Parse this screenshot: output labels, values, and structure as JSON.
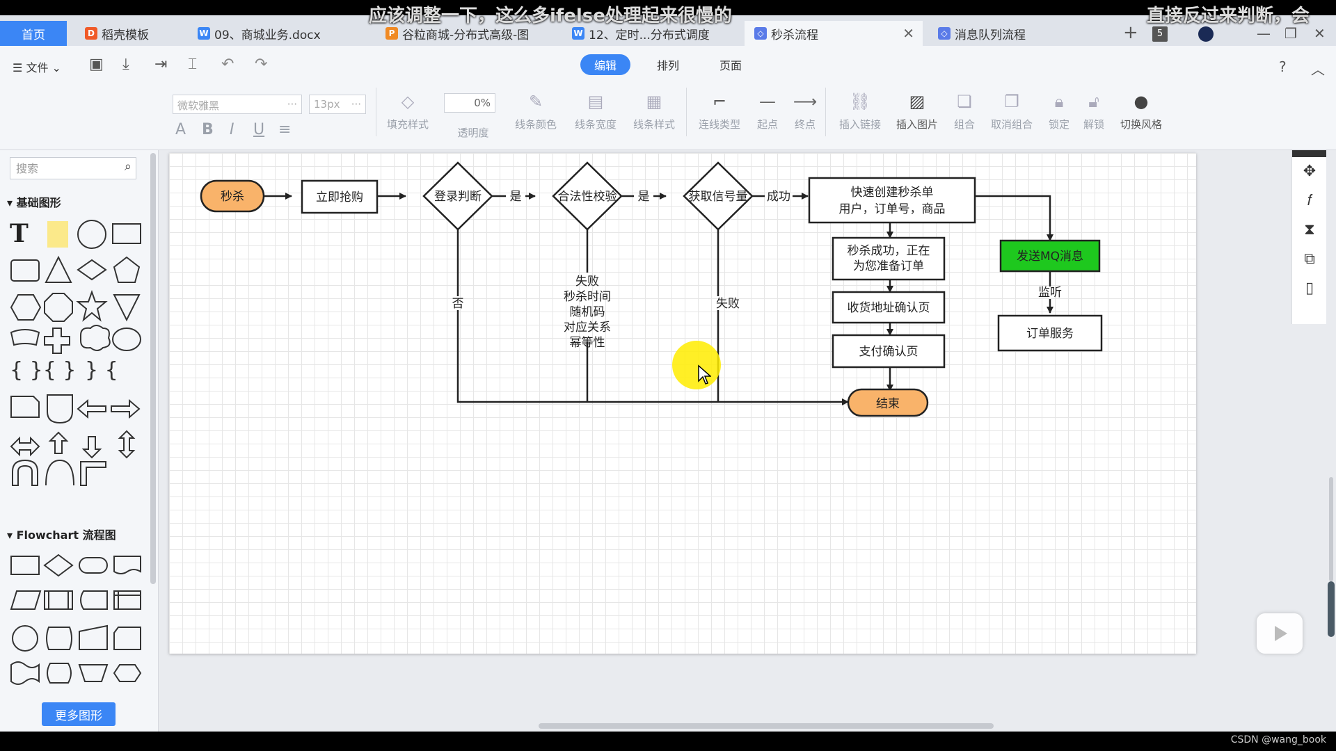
{
  "captions": [
    "应该调整一下，这么多ifelse处理起来很慢的",
    "直接反过来判断，会"
  ],
  "tabs": [
    {
      "label": "首页"
    },
    {
      "label": "稻壳模板",
      "icon": "D"
    },
    {
      "label": "09、商城业务.docx",
      "icon": "W"
    },
    {
      "label": "谷粒商城-分布式高级-图",
      "icon": "P"
    },
    {
      "label": "12、定时...分布式调度",
      "icon": "W"
    },
    {
      "label": "秒杀流程",
      "icon": "◇"
    },
    {
      "label": "消息队列流程",
      "icon": "◇"
    }
  ],
  "tab_count": "5",
  "toolbar": {
    "file_menu": "文件",
    "modes": [
      "编辑",
      "排列",
      "页面"
    ],
    "font_placeholder": "微软雅黑",
    "font_size_placeholder": "13px",
    "opacity_value": "0%",
    "tools": [
      "填充样式",
      "透明度",
      "线条颜色",
      "线条宽度",
      "线条样式",
      "连线类型",
      "起点",
      "终点",
      "插入链接",
      "插入图片",
      "组合",
      "取消组合",
      "锁定",
      "解锁",
      "切换风格"
    ]
  },
  "sidebar": {
    "search_placeholder": "搜索",
    "section_basic": "基础图形",
    "section_flowchart": "Flowchart 流程图",
    "more_shapes": "更多图形"
  },
  "diagram": {
    "nodes": {
      "start": "秒杀",
      "buy": "立即抢购",
      "login": "登录判断",
      "valid": "合法性校验",
      "signal": "获取信号量",
      "create1": "快速创建秒杀单",
      "create2": "用户，订单号，商品",
      "success1": "秒杀成功，正在",
      "success2": "为您准备订单",
      "address": "收货地址确认页",
      "pay": "支付确认页",
      "end": "结束",
      "mq": "发送MQ消息",
      "order": "订单服务"
    },
    "edges": {
      "yes1": "是",
      "yes2": "是",
      "success": "成功",
      "no": "否",
      "fail_signal": "失败",
      "listen": "监听"
    },
    "fail_note": [
      "失败",
      "秒杀时间",
      "随机码",
      "对应关系",
      "幂等性"
    ]
  },
  "watermark": "CSDN @wang_book",
  "colors": {
    "accent": "#3b86f5",
    "terminal_fill": "#f9b36a",
    "mq_fill": "#1ec81e"
  }
}
